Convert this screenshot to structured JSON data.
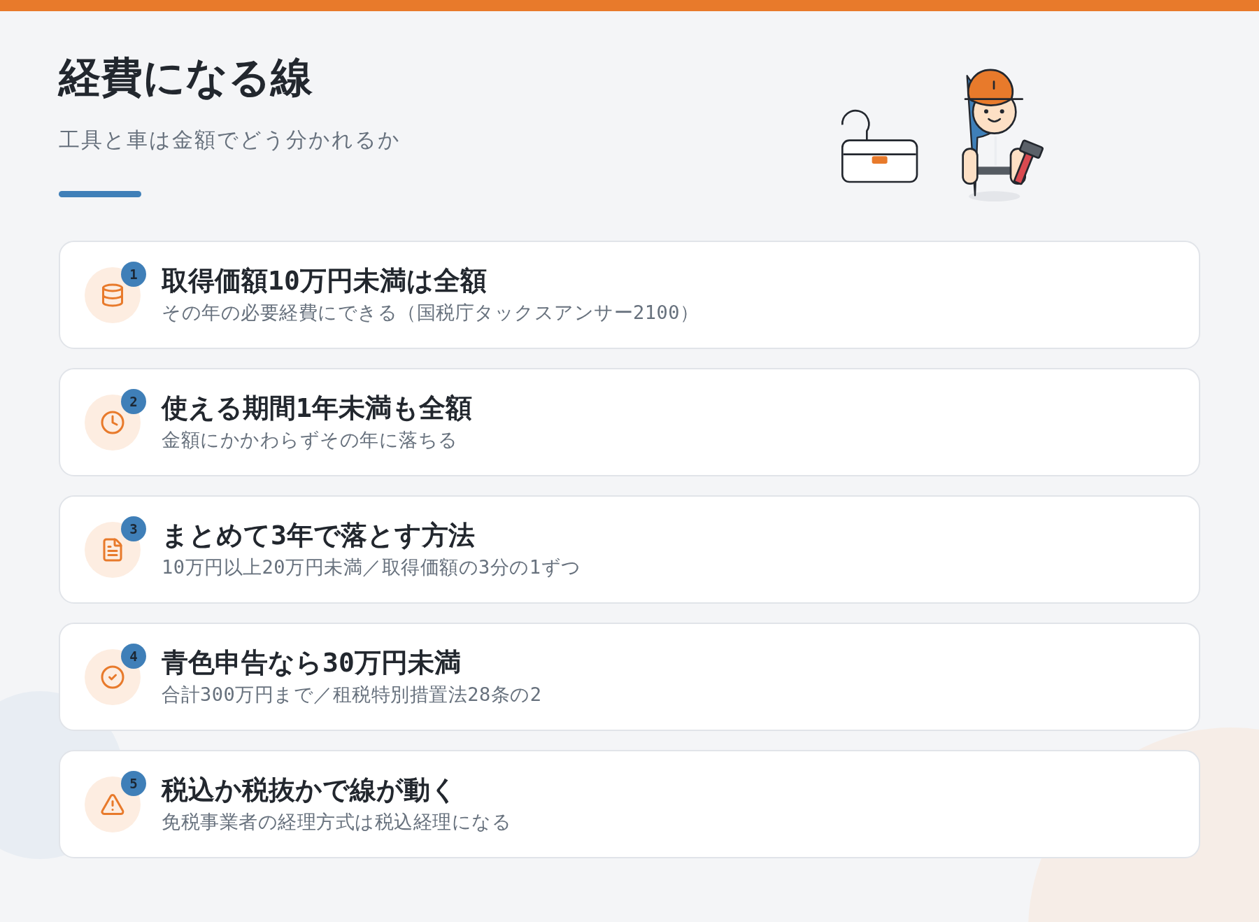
{
  "header": {
    "title": "経費になる線",
    "subtitle": "工具と車は金額でどう分かれるか"
  },
  "items": [
    {
      "number": "1",
      "kind": "coins",
      "title": "取得価額10万円未満は全額",
      "description": "その年の必要経費にできる（国税庁タックスアンサー2100）"
    },
    {
      "number": "2",
      "kind": "clock",
      "title": "使える期間1年未満も全額",
      "description": "金額にかかわらずその年に落ちる"
    },
    {
      "number": "3",
      "kind": "document",
      "title": "まとめて3年で落とす方法",
      "description": "10万円以上20万円未満／取得価額の3分の1ずつ"
    },
    {
      "number": "4",
      "kind": "check",
      "title": "青色申告なら30万円未満",
      "description": "合計300万円まで／租税特別措置法28条の2"
    },
    {
      "number": "5",
      "kind": "warning",
      "title": "税込か税抜かで線が動く",
      "description": "免税事業者の経理方式は税込経理になる"
    }
  ]
}
